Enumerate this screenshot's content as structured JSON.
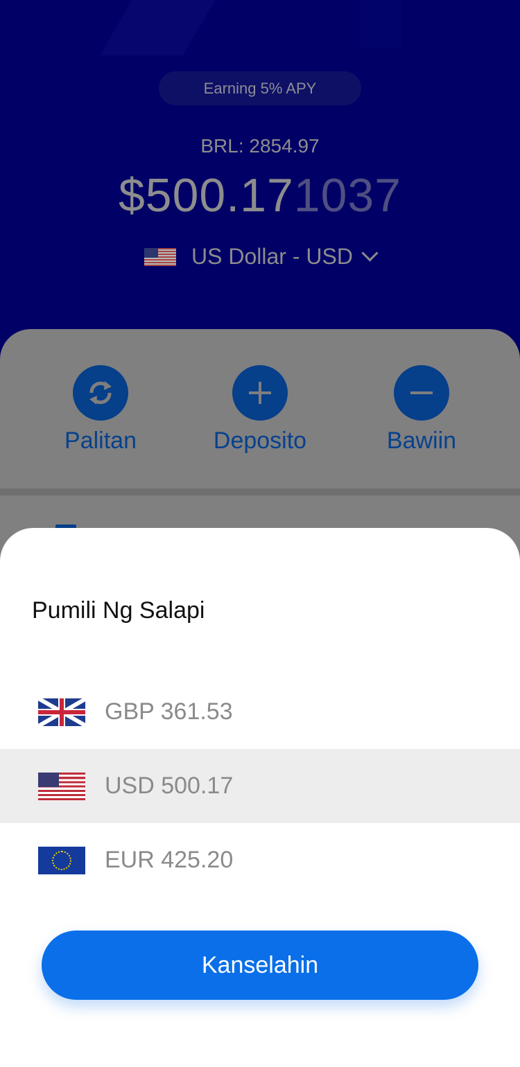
{
  "header": {
    "apy_badge": "Earning 5% APY",
    "brl_line": "BRL: 2854.97",
    "balance_main": "$500.17",
    "balance_fraction": "1037",
    "currency_label": "US Dollar - USD"
  },
  "actions": [
    {
      "label": "Palitan",
      "icon": "swap-icon"
    },
    {
      "label": "Deposito",
      "icon": "plus-icon"
    },
    {
      "label": "Bawiin",
      "icon": "minus-icon"
    }
  ],
  "sheet": {
    "title": "Pumili Ng Salapi",
    "options": [
      {
        "flag": "uk-flag-icon",
        "text": "GBP 361.53",
        "selected": false
      },
      {
        "flag": "us-flag-icon",
        "text": "USD 500.17",
        "selected": true
      },
      {
        "flag": "eu-flag-icon",
        "text": "EUR 425.20",
        "selected": false
      }
    ],
    "cancel_label": "Kanselahin"
  },
  "colors": {
    "hero_bg": "#010066",
    "action_blue": "#063f8a",
    "primary_button": "#0a6fe9",
    "selected_row": "#ededed"
  }
}
